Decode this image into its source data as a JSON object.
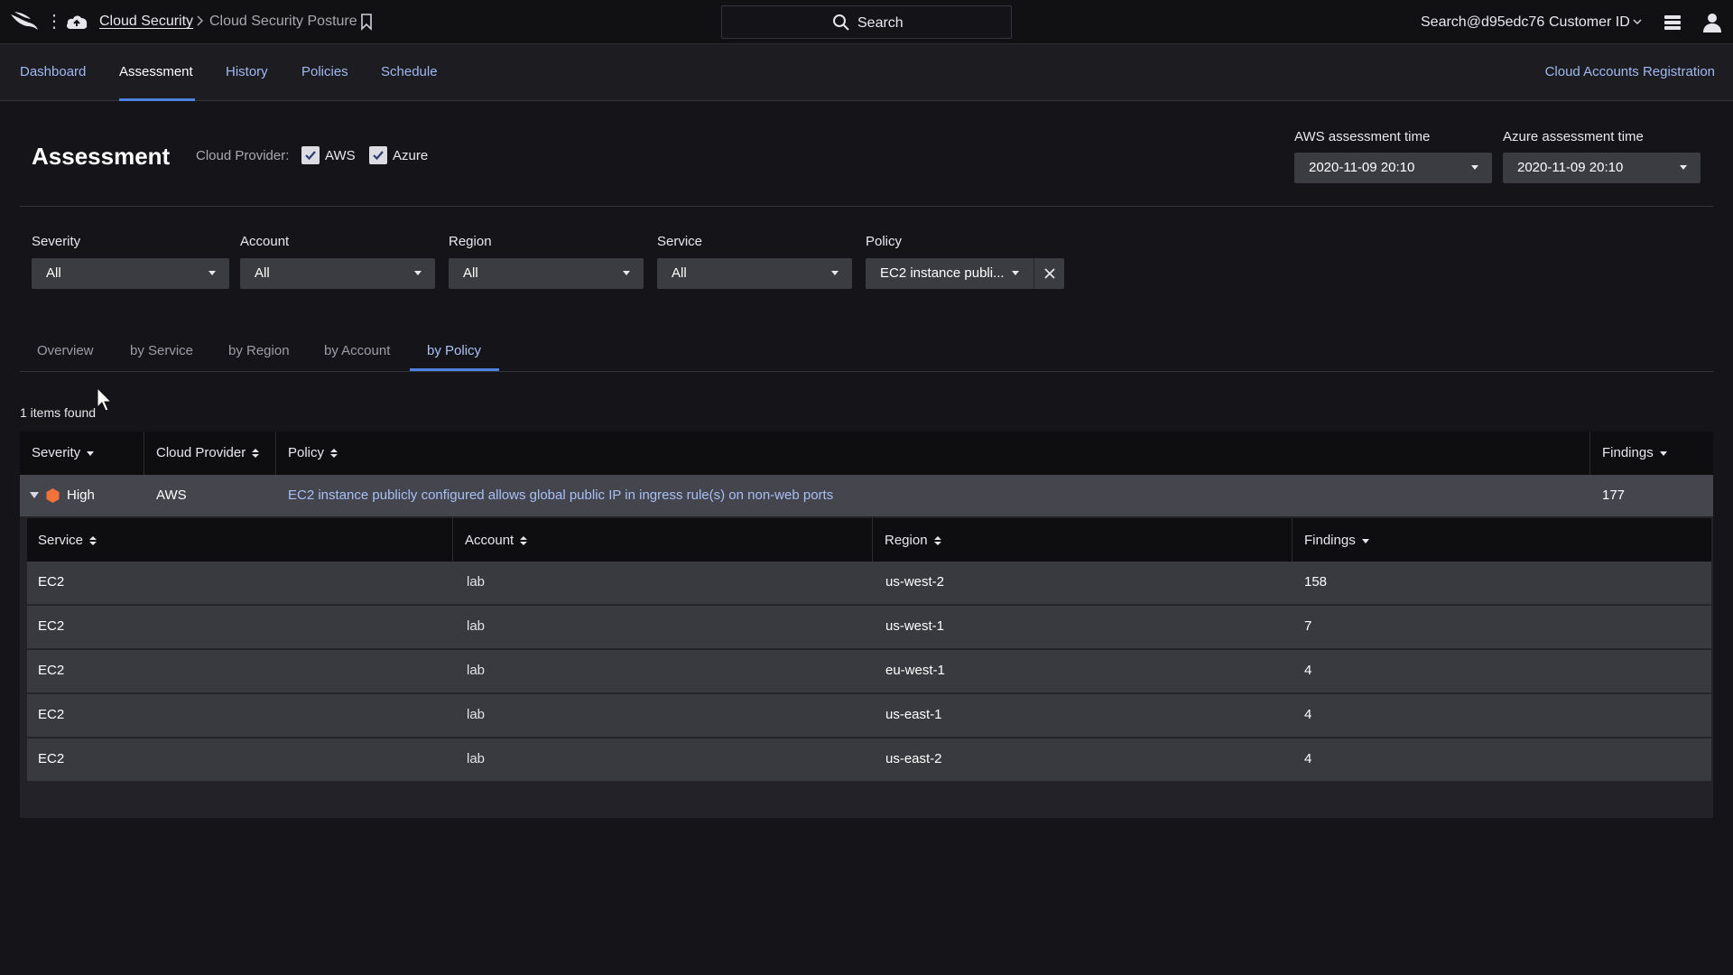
{
  "topbar": {
    "breadcrumb_app": "Cloud Security",
    "breadcrumb_page": "Cloud Security Posture",
    "search_label": "Search",
    "user": "Search@d95edc76",
    "customer_id": "Customer ID"
  },
  "nav": {
    "items": [
      "Dashboard",
      "Assessment",
      "History",
      "Policies",
      "Schedule"
    ],
    "active": "Assessment",
    "right_link": "Cloud Accounts Registration"
  },
  "header": {
    "title": "Assessment",
    "cloud_provider_label": "Cloud Provider:",
    "providers": [
      {
        "label": "AWS",
        "checked": true
      },
      {
        "label": "Azure",
        "checked": true
      }
    ],
    "aws_time_label": "AWS assessment time",
    "aws_time_value": "2020-11-09 20:10",
    "azure_time_label": "Azure assessment time",
    "azure_time_value": "2020-11-09 20:10"
  },
  "filters": {
    "severity": {
      "label": "Severity",
      "value": "All"
    },
    "account": {
      "label": "Account",
      "value": "All"
    },
    "region": {
      "label": "Region",
      "value": "All"
    },
    "service": {
      "label": "Service",
      "value": "All"
    },
    "policy": {
      "label": "Policy",
      "value": "EC2 instance publi..."
    }
  },
  "tabs": [
    "Overview",
    "by Service",
    "by Region",
    "by Account",
    "by Policy"
  ],
  "active_tab": "by Policy",
  "items_found": "1 items found",
  "table": {
    "columns": [
      "Severity",
      "Cloud Provider",
      "Policy",
      "Findings"
    ],
    "row": {
      "severity": "High",
      "cloud_provider": "AWS",
      "policy": "EC2 instance publicly configured allows global public IP in ingress rule(s) on non-web ports",
      "findings": "177"
    },
    "sub_columns": [
      "Service",
      "Account",
      "Region",
      "Findings"
    ],
    "sub_rows": [
      {
        "service": "EC2",
        "account": "lab",
        "region": "us-west-2",
        "findings": "158"
      },
      {
        "service": "EC2",
        "account": "lab",
        "region": "us-west-1",
        "findings": "7"
      },
      {
        "service": "EC2",
        "account": "lab",
        "region": "eu-west-1",
        "findings": "4"
      },
      {
        "service": "EC2",
        "account": "lab",
        "region": "us-east-1",
        "findings": "4"
      },
      {
        "service": "EC2",
        "account": "lab",
        "region": "us-east-2",
        "findings": "4"
      }
    ]
  },
  "colors": {
    "accent": "#4f82e0",
    "link": "#9fb9f2",
    "severity_high": "#f2733a",
    "findings": "#f2733a"
  }
}
